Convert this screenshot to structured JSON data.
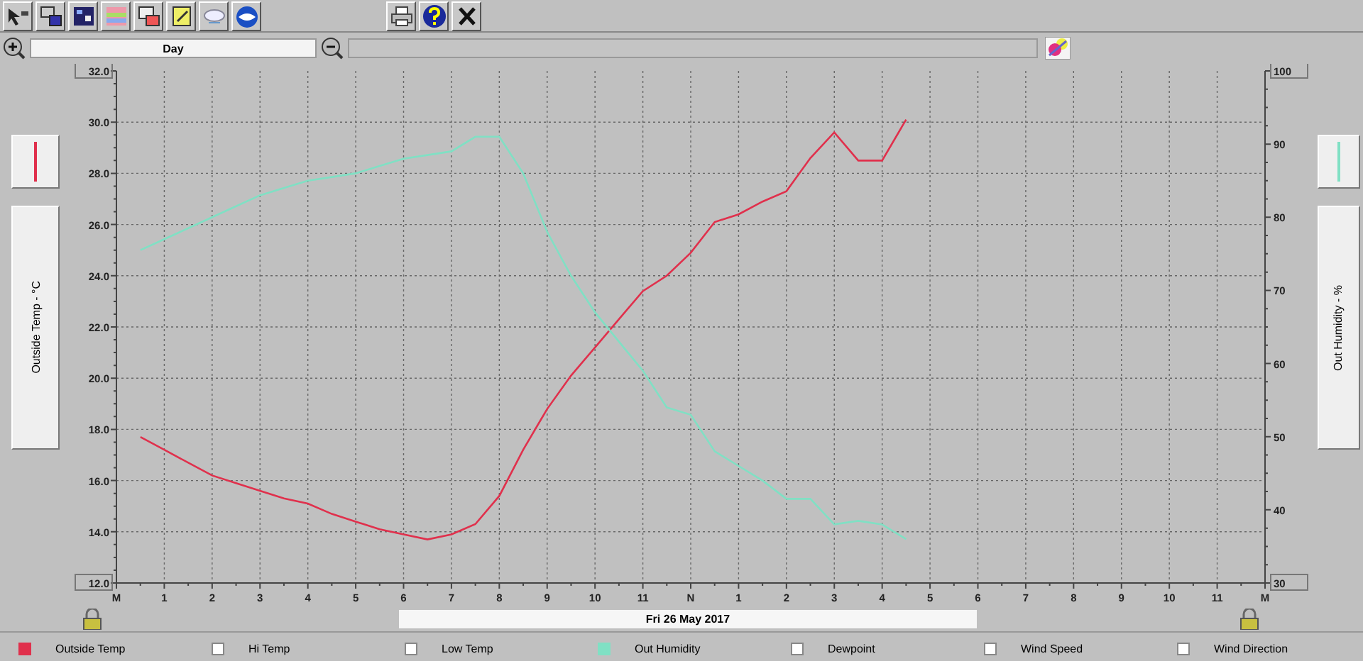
{
  "range_field": {
    "value": "Day"
  },
  "date_bar": {
    "text": "Fri 26 May 2017"
  },
  "left_axis": {
    "label": "Outside Temp - °C",
    "color": "#e0304c"
  },
  "right_axis": {
    "label": "Out Humidity - %",
    "color": "#80e0c4"
  },
  "chart": {
    "chart_data": {
      "type": "line",
      "categories": [
        "M",
        null,
        "1",
        null,
        "2",
        null,
        "3",
        null,
        "4",
        null,
        "5",
        null,
        "6",
        null,
        "7",
        null,
        "8",
        null,
        "9",
        null,
        "10",
        null,
        "11",
        null,
        "N",
        null,
        "1",
        null,
        "2",
        null,
        "3",
        null,
        "4",
        null,
        "5",
        null,
        "6",
        null,
        "7",
        null,
        "8",
        null,
        "9",
        null,
        "10",
        null,
        "11",
        null,
        "M"
      ],
      "grid": true,
      "ylim": [
        12,
        32
      ],
      "yticks": [
        {
          "value": 32,
          "label": "32.0"
        },
        {
          "value": 30,
          "label": "30.0"
        },
        {
          "value": 28,
          "label": "28.0"
        },
        {
          "value": 26,
          "label": "26.0"
        },
        {
          "value": 24,
          "label": "24.0"
        },
        {
          "value": 22,
          "label": "22.0"
        },
        {
          "value": 20,
          "label": "20.0"
        },
        {
          "value": 18,
          "label": "18.0"
        },
        {
          "value": 16,
          "label": "16.0"
        },
        {
          "value": 14,
          "label": "14.0"
        },
        {
          "value": 12,
          "label": "12.0"
        }
      ],
      "y2lim": [
        30,
        100
      ],
      "y2ticks": [
        100,
        90,
        80,
        70,
        60,
        50,
        40,
        30
      ],
      "series": [
        {
          "color": "#e0304c",
          "values": [
            null,
            17.7,
            17.2,
            16.7,
            16.2,
            15.9,
            15.6,
            15.3,
            15.1,
            14.7,
            14.4,
            14.1,
            13.9,
            13.7,
            13.9,
            14.3,
            15.4,
            17.2,
            18.8,
            20.1,
            21.2,
            22.3,
            23.4,
            24.0,
            24.9,
            26.1,
            26.4,
            26.9,
            27.3,
            28.6,
            29.6,
            28.5,
            28.5,
            30.1,
            null,
            null,
            null,
            null,
            null,
            null,
            null,
            null,
            null,
            null,
            null,
            null,
            null,
            null,
            null
          ]
        },
        {
          "color": "#80e0c4",
          "axis": "y2",
          "values": [
            null,
            75.5,
            77,
            78.5,
            80,
            81.5,
            83,
            84,
            85,
            85.5,
            86,
            87,
            88,
            88.5,
            89,
            91,
            91,
            86,
            78,
            72,
            67,
            63,
            59,
            54,
            53,
            48,
            46,
            44,
            41.5,
            41.5,
            38,
            38.5,
            38,
            36,
            null,
            null,
            null,
            null,
            null,
            null,
            null,
            null,
            null,
            null,
            null,
            null,
            null,
            null,
            null
          ]
        }
      ]
    }
  },
  "legend": [
    {
      "label": "Outside Temp",
      "checked": true,
      "color": "#e0304c"
    },
    {
      "label": "Hi Temp",
      "checked": false
    },
    {
      "label": "Low Temp",
      "checked": false
    },
    {
      "label": "Out Humidity",
      "checked": true,
      "color": "#80e0c4"
    },
    {
      "label": "Dewpoint",
      "checked": false
    },
    {
      "label": "Wind Speed",
      "checked": false
    },
    {
      "label": "Wind Direction",
      "checked": false
    }
  ]
}
